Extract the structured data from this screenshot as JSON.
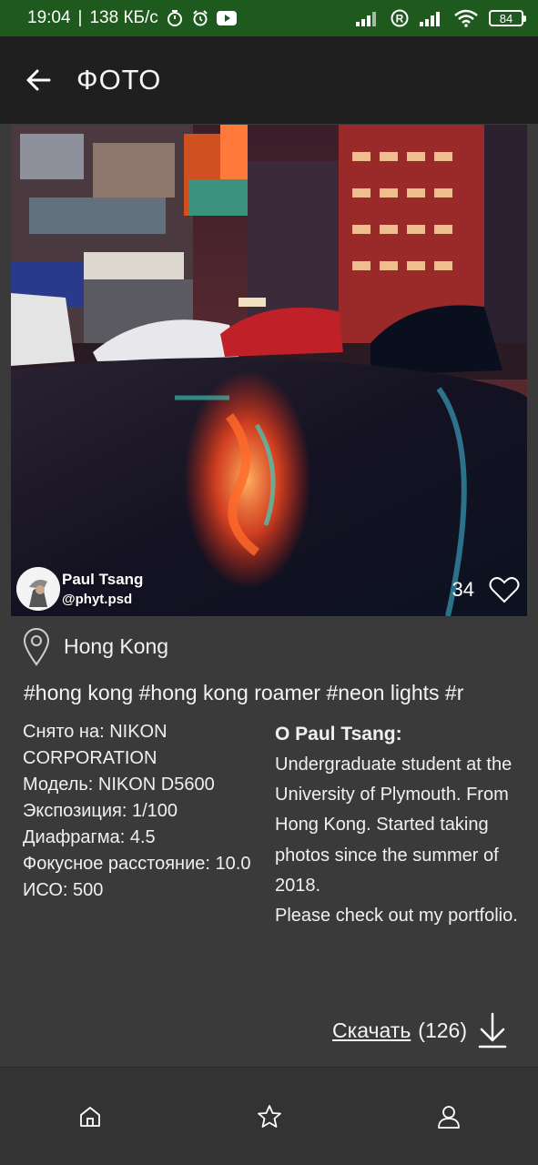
{
  "status_bar": {
    "time": "19:04",
    "speed": "138 КБ/с",
    "battery": "84",
    "icons": [
      "timer-icon",
      "alarm-icon",
      "youtube-icon",
      "signal-icon",
      "roaming-icon",
      "signal-icon",
      "wifi-icon",
      "battery-icon"
    ]
  },
  "app_bar": {
    "title": "ФОТО",
    "back_icon": "arrow-left-icon"
  },
  "photo": {
    "author_name": "Paul Tsang",
    "author_handle": "@phyt.psd",
    "likes": "34"
  },
  "location": {
    "label": "Hong Kong",
    "icon": "map-pin-icon"
  },
  "tags": "#hong kong #hong kong roamer #neon lights #r",
  "exif": {
    "camera": "Снято на: NIKON CORPORATION",
    "model": "Модель: NIKON D5600",
    "exposure": "Экспозиция: 1/100",
    "aperture": "Диафрагма: 4.5",
    "focal": "Фокусное расстояние: 10.0",
    "iso": "ИСО: 500"
  },
  "about": {
    "title": "О Paul Tsang:",
    "body": "Undergraduate student at the University of Plymouth. From Hong Kong. Started taking photos since the summer of 2018.\nPlease check out my portfolio."
  },
  "download": {
    "label": "Скачать",
    "count": "(126)"
  },
  "bottom_nav": {
    "items": [
      "home-icon",
      "star-icon",
      "user-icon"
    ]
  }
}
